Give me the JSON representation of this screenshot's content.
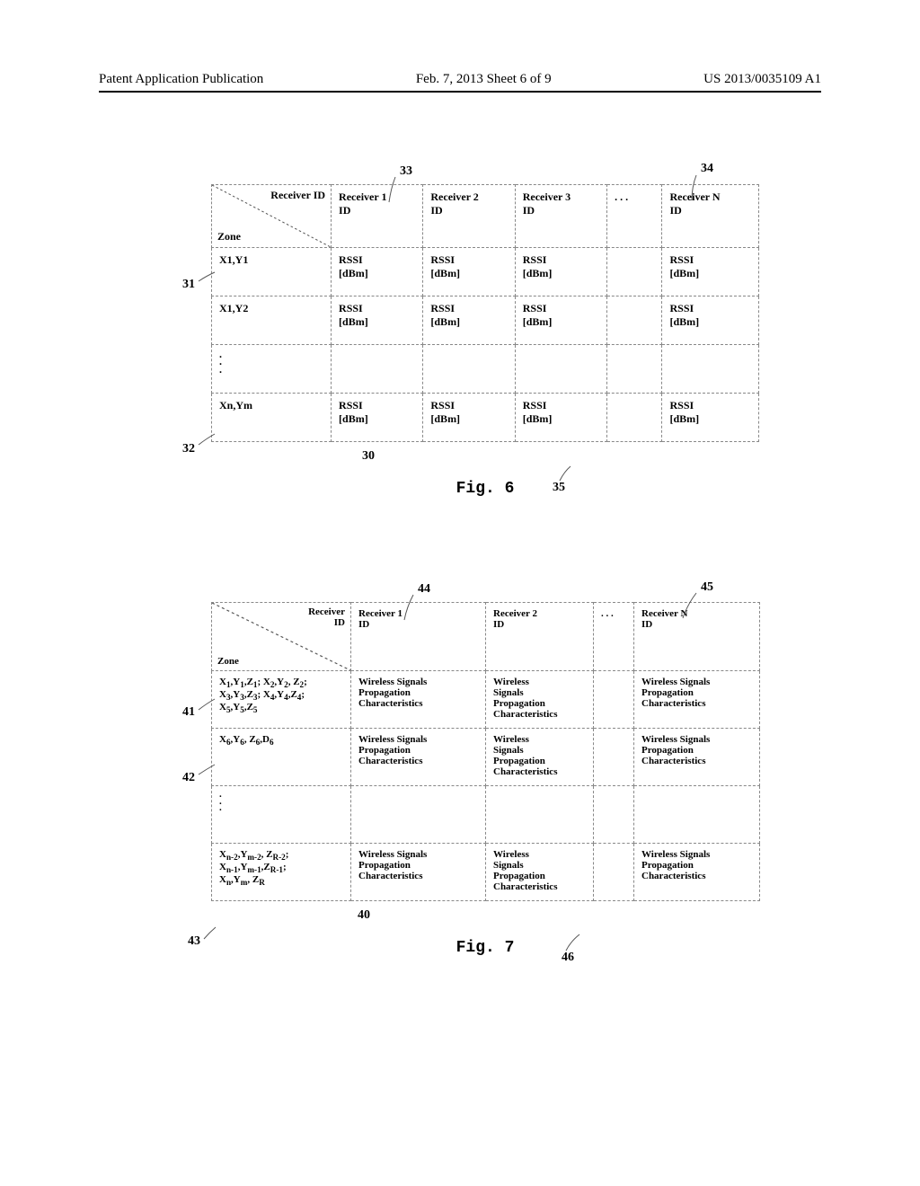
{
  "header": {
    "left": "Patent Application Publication",
    "center": "Feb. 7, 2013  Sheet 6 of 9",
    "right": "US 2013/0035109 A1"
  },
  "fig6": {
    "callouts": {
      "n33": "33",
      "n34": "34",
      "n31": "31",
      "n32": "32",
      "n30": "30",
      "n35": "35"
    },
    "caption": "Fig. 6",
    "header": {
      "diag_top": "Receiver ID",
      "diag_bottom": "Zone",
      "c1": "Receiver 1\nID",
      "c2": "Receiver 2\nID",
      "c3": "Receiver 3\nID",
      "c4": ". . .",
      "c5": "Receiver N\nID"
    },
    "rows": [
      {
        "zone": "X1,Y1",
        "v1": "RSSI\n[dBm]",
        "v2": "RSSI\n[dBm]",
        "v3": "RSSI\n[dBm]",
        "v4": "",
        "v5": "RSSI\n[dBm]"
      },
      {
        "zone": "X1,Y2",
        "v1": "RSSI\n[dBm]",
        "v2": "RSSI\n[dBm]",
        "v3": "RSSI\n[dBm]",
        "v4": "",
        "v5": "RSSI\n[dBm]"
      },
      {
        "zone": "⋮",
        "v1": "",
        "v2": "",
        "v3": "",
        "v4": "",
        "v5": ""
      },
      {
        "zone": "Xn,Ym",
        "v1": "RSSI\n[dBm]",
        "v2": "RSSI\n[dBm]",
        "v3": "RSSI\n[dBm]",
        "v4": "",
        "v5": "RSSI\n[dBm]"
      }
    ]
  },
  "fig7": {
    "callouts": {
      "n44": "44",
      "n45": "45",
      "n41": "41",
      "n42": "42",
      "n43": "43",
      "n40": "40",
      "n46": "46"
    },
    "caption": "Fig. 7",
    "header": {
      "diag_top": "Receiver\nID",
      "diag_bottom": "Zone",
      "c1": "Receiver 1\nID",
      "c2": "Receiver 2\nID",
      "c3": ". . .",
      "c4": "Receiver N\nID"
    },
    "rows": [
      {
        "zone_html": "X<sub>1</sub>,Y<sub>1</sub>,Z<sub>1</sub>; X<sub>2</sub>,Y<sub>2</sub>, Z<sub>2</sub>;<br>X<sub>3</sub>,Y<sub>3</sub>,Z<sub>3</sub>; X<sub>4</sub>,Y<sub>4</sub>,Z<sub>4</sub>;<br>X<sub>5</sub>,Y<sub>5</sub>,Z<sub>5</sub>",
        "v1": "Wireless Signals\nPropagation\nCharacteristics",
        "v2": "Wireless\nSignals\nPropagation\nCharacteristics",
        "v3": "",
        "v4": "Wireless Signals\nPropagation\nCharacteristics"
      },
      {
        "zone_html": "X<sub>6</sub>,Y<sub>6</sub>, Z<sub>6</sub>,D<sub>6</sub>",
        "v1": "Wireless Signals\nPropagation\nCharacteristics",
        "v2": "Wireless\nSignals\nPropagation\nCharacteristics",
        "v3": "",
        "v4": "Wireless Signals\nPropagation\nCharacteristics"
      },
      {
        "zone_html": "⋮",
        "v1": "",
        "v2": "",
        "v3": "",
        "v4": ""
      },
      {
        "zone_html": "X<sub>n-2</sub>,Y<sub>m-2</sub>, Z<sub>R-2</sub>;<br>X<sub>n-1</sub>,Y<sub>m-1</sub>,Z<sub>R-1</sub>;<br>X<sub>n</sub>,Y<sub>m</sub>, Z<sub>R</sub>",
        "v1": "Wireless Signals\nPropagation\nCharacteristics",
        "v2": "Wireless\nSignals\nPropagation\nCharacteristics",
        "v3": "",
        "v4": "Wireless Signals\nPropagation\nCharacteristics"
      }
    ]
  },
  "chart_data": [
    {
      "type": "table",
      "title": "Fig. 6 – Zone vs Receiver RSSI matrix",
      "columns": [
        "Zone",
        "Receiver 1 ID",
        "Receiver 2 ID",
        "Receiver 3 ID",
        "...",
        "Receiver N ID"
      ],
      "rows": [
        [
          "X1,Y1",
          "RSSI [dBm]",
          "RSSI [dBm]",
          "RSSI [dBm]",
          "",
          "RSSI [dBm]"
        ],
        [
          "X1,Y2",
          "RSSI [dBm]",
          "RSSI [dBm]",
          "RSSI [dBm]",
          "",
          "RSSI [dBm]"
        ],
        [
          "⋮",
          "",
          "",
          "",
          "",
          ""
        ],
        [
          "Xn,Ym",
          "RSSI [dBm]",
          "RSSI [dBm]",
          "RSSI [dBm]",
          "",
          "RSSI [dBm]"
        ]
      ],
      "annotations_refnums": {
        "30": "table",
        "31": "row X1,Y1",
        "32": "row Xn,Ym",
        "33": "column Receiver 1",
        "34": "column Receiver N",
        "35": "cell bottom-right area"
      }
    },
    {
      "type": "table",
      "title": "Fig. 7 – Zone (3D) vs Receiver propagation characteristics",
      "columns": [
        "Zone",
        "Receiver 1 ID",
        "Receiver 2 ID",
        "...",
        "Receiver N ID"
      ],
      "rows": [
        [
          "X1,Y1,Z1; X2,Y2,Z2; X3,Y3,Z3; X4,Y4,Z4; X5,Y5,Z5",
          "Wireless Signals Propagation Characteristics",
          "Wireless Signals Propagation Characteristics",
          "",
          "Wireless Signals Propagation Characteristics"
        ],
        [
          "X6,Y6,Z6,D6",
          "Wireless Signals Propagation Characteristics",
          "Wireless Signals Propagation Characteristics",
          "",
          "Wireless Signals Propagation Characteristics"
        ],
        [
          "⋮",
          "",
          "",
          "",
          ""
        ],
        [
          "X(n-2),Y(m-2),Z(R-2); X(n-1),Y(m-1),Z(R-1); Xn,Ym,ZR",
          "Wireless Signals Propagation Characteristics",
          "Wireless Signals Propagation Characteristics",
          "",
          "Wireless Signals Propagation Characteristics"
        ]
      ],
      "annotations_refnums": {
        "40": "table",
        "41": "row group 1",
        "42": "row group 2",
        "43": "last row",
        "44": "column Receiver 1",
        "45": "column Receiver N",
        "46": "cell bottom area"
      }
    }
  ]
}
